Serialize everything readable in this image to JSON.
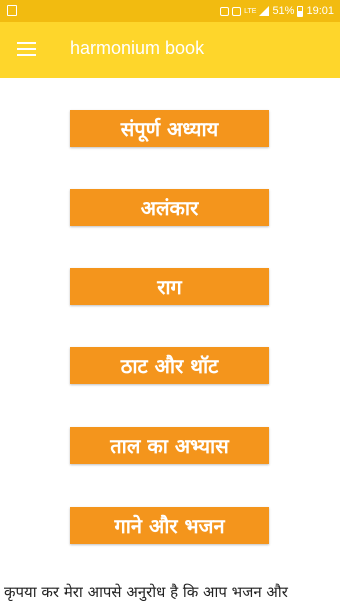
{
  "status_bar": {
    "battery": "51%",
    "time": "19:01",
    "network": "LTE",
    "icons": [
      "notification-icon",
      "alarm-icon",
      "nfc-icon",
      "lte-icon",
      "signal-icon",
      "battery-icon"
    ]
  },
  "app_bar": {
    "title": "harmonium book",
    "menu_icon": "hamburger-menu-icon"
  },
  "menu": {
    "items": [
      {
        "label": "संपूर्ण अध्याय"
      },
      {
        "label": "अलंकार"
      },
      {
        "label": "राग"
      },
      {
        "label": "ठाट और थॉट"
      },
      {
        "label": "ताल का अभ्यास"
      },
      {
        "label": "गाने और भजन"
      }
    ]
  },
  "footer": {
    "text": "कृपया कर मेरा आपसे अनुरोध है कि आप भजन और"
  },
  "colors": {
    "status_bar": "#f2bb10",
    "app_bar": "#fed62b",
    "button": "#f4951c",
    "button_text": "#ffffff"
  }
}
